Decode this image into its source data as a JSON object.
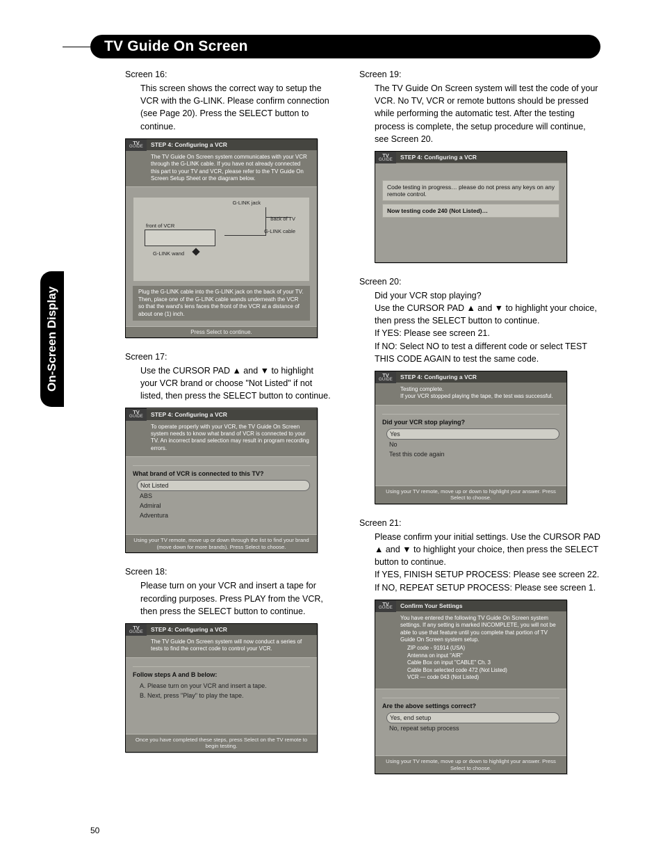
{
  "page_number": "50",
  "side_tab": "On-Screen Display",
  "title": "TV Guide On Screen",
  "left": {
    "s16": {
      "label": "Screen 16:",
      "body": "This screen shows the correct way to setup the VCR with the G-LINK.  Please confirm connection (see Page 20).  Press the SELECT button to continue.",
      "panel": {
        "step": "STEP 4: Configuring a VCR",
        "intro": "The TV Guide On Screen system communicates with your VCR through the G-LINK cable. If you have not already connected this part to your TV and VCR, please refer to the TV Guide On Screen Setup Sheet or the diagram below.",
        "diag_vcr": "front of VCR",
        "diag_tv": "back of TV",
        "diag_glink": "G-LINK jack",
        "diag_cable": "G-LINK cable",
        "diag_wand": "G-LINK wand",
        "note": "Plug the G-LINK cable into the G-LINK jack on the back of your TV. Then, place one of the G-LINK cable wands underneath the VCR so that the wand's lens faces the front of the VCR at a distance of about one (1) inch.",
        "footer": "Press Select to continue."
      }
    },
    "s17": {
      "label": "Screen 17:",
      "body": "Use the CURSOR PAD ▲ and ▼ to highlight your VCR brand or choose \"Not Listed\" if not listed, then press the SELECT button to continue.",
      "panel": {
        "step": "STEP 4: Configuring a VCR",
        "intro": "To operate properly with your VCR, the TV Guide On Screen system needs to know what brand of VCR is connected to your TV. An incorrect brand selection may result in program recording errors.",
        "question": "What brand of VCR is connected to this TV?",
        "opts": [
          "Not Listed",
          "ABS",
          "Admiral",
          "Adventura"
        ],
        "hint": "Using your TV remote, move up or down through the list to find your brand (move down for more brands). Press Select to choose."
      }
    },
    "s18": {
      "label": "Screen 18:",
      "body": "Please turn on your VCR and insert a tape for recording purposes.  Press PLAY from the VCR, then press the SELECT button to continue.",
      "panel": {
        "step": "STEP 4: Configuring a VCR",
        "intro": "The TV Guide On Screen system will now conduct a series of tests to find the correct code to control your VCR.",
        "question": "Follow steps A and B below:",
        "stepA": "A.   Please turn on your VCR and insert a tape.",
        "stepB": "B.   Next, press \"Play\" to play the tape.",
        "hint": "Once you have completed these steps, press Select on the TV remote to begin testing."
      }
    }
  },
  "right": {
    "s19": {
      "label": "Screen 19:",
      "body": "The TV Guide On Screen system will test the code of your VCR.  No TV, VCR or remote buttons should be pressed while performing the automatic test.  After the testing process is complete, the setup procedure will continue, see Screen 20.",
      "panel": {
        "step": "STEP 4: Configuring a VCR",
        "msg1": "Code testing in progress… please do not press any keys on any remote control.",
        "msg2": "Now testing code 240 (Not Listed)…"
      }
    },
    "s20": {
      "label": "Screen 20:",
      "body": "Did your VCR stop playing?\nUse the CURSOR PAD ▲ and ▼ to highlight your choice, then press the SELECT button to continue.\nIf YES: Please see screen 21.\nIf NO: Select NO to test a different code or select TEST THIS CODE AGAIN to test the same code.",
      "panel": {
        "step": "STEP 4: Configuring a VCR",
        "intro": "Testing complete.\nIf your VCR stopped playing the tape, the test was successful.",
        "question": "Did your VCR stop playing?",
        "opts": [
          "Yes",
          "No",
          "Test this code again"
        ],
        "hint": "Using your TV remote, move up or down to highlight your answer.  Press Select to choose."
      }
    },
    "s21": {
      "label": "Screen 21:",
      "body": "Please confirm your initial settings.  Use the CURSOR PAD ▲ and ▼ to highlight your choice, then press the SELECT button to continue.\nIf YES, FINISH SETUP PROCESS: Please see screen 22.\nIf NO, REPEAT SETUP PROCESS: Please see screen 1.",
      "panel": {
        "step": "Confirm Your Settings",
        "intro": "You have entered the following TV Guide On Screen system settings. If any setting is marked INCOMPLETE, you will not be able to use that feature until you complete that portion of TV Guide On Screen system setup.",
        "settings": [
          "ZIP code - 91914 (USA)",
          "Antenna on input \"AIR\"",
          "Cable Box on input \"CABLE\" Ch. 3",
          "Cable Box selected code 472 (Not Listed)",
          "VCR — code 043 (Not Listed)"
        ],
        "question": "Are the above settings correct?",
        "opts": [
          "Yes, end setup",
          "No, repeat setup process"
        ],
        "hint": "Using your TV remote, move up or down to highlight your answer.  Press Select to choose."
      }
    }
  },
  "logo_top": "TV",
  "logo_bottom": "GUIDE"
}
